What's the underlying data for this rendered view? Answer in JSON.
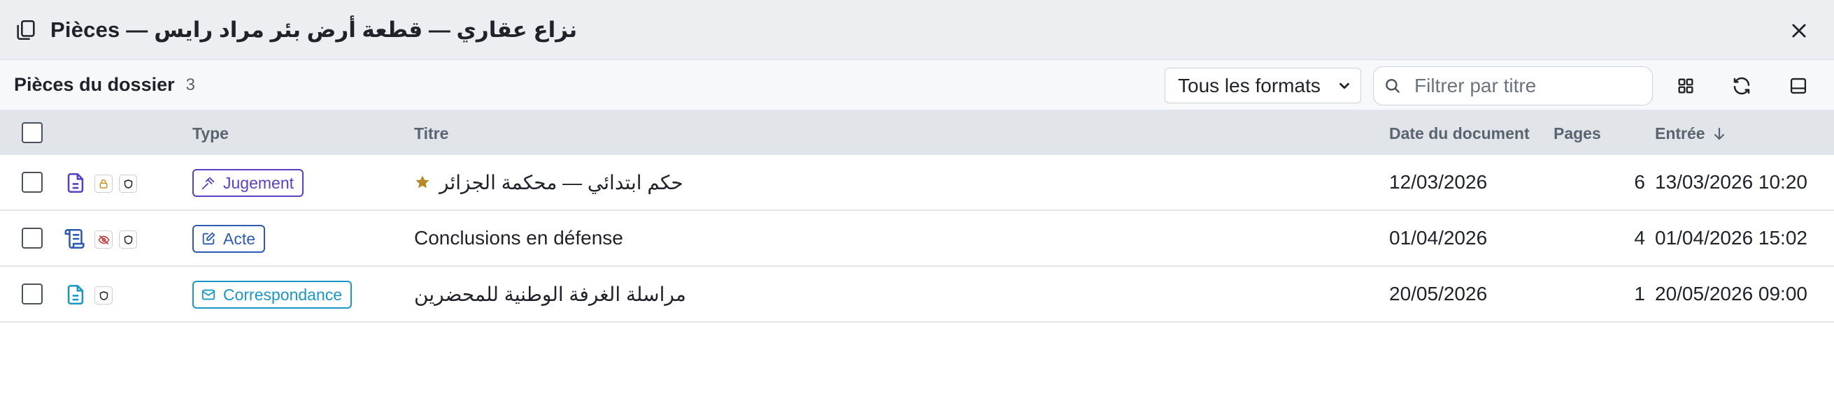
{
  "window": {
    "title": "Pièces — نزاع عقاري — قطعة أرض بئر مراد رايس"
  },
  "toolbar": {
    "section_title": "Pièces du dossier",
    "count": "3",
    "format_select": "Tous les formats",
    "search_placeholder": "Filtrer par titre"
  },
  "columns": {
    "type": "Type",
    "title": "Titre",
    "doc_date": "Date du document",
    "pages": "Pages",
    "entry": "Entrée",
    "sort": "descending"
  },
  "rows": [
    {
      "type": "Jugement",
      "title": "حكم ابتدائي — محكمة الجزائر",
      "doc_date": "12/03/2026",
      "pages": "6",
      "entry": "13/03/2026 10:20",
      "starred": true,
      "icons": [
        "document-icon",
        "lock-icon",
        "shield-icon"
      ]
    },
    {
      "type": "Acte",
      "title": "Conclusions en défense",
      "doc_date": "01/04/2026",
      "pages": "4",
      "entry": "01/04/2026 15:02",
      "starred": false,
      "icons": [
        "scroll-icon",
        "eye-off-icon",
        "shield-icon"
      ]
    },
    {
      "type": "Correspondance",
      "title": "مراسلة الغرفة الوطنية للمحضرين",
      "doc_date": "20/05/2026",
      "pages": "1",
      "entry": "20/05/2026 09:00",
      "starred": false,
      "icons": [
        "document-icon",
        "shield-icon"
      ]
    }
  ],
  "colors": {
    "jugement": "#5b3fc4",
    "acte": "#2d5ab3",
    "correspondance": "#1a97c4",
    "star": "#b58a2a",
    "lock": "#c4962c",
    "eye_off": "#c23b3b"
  }
}
